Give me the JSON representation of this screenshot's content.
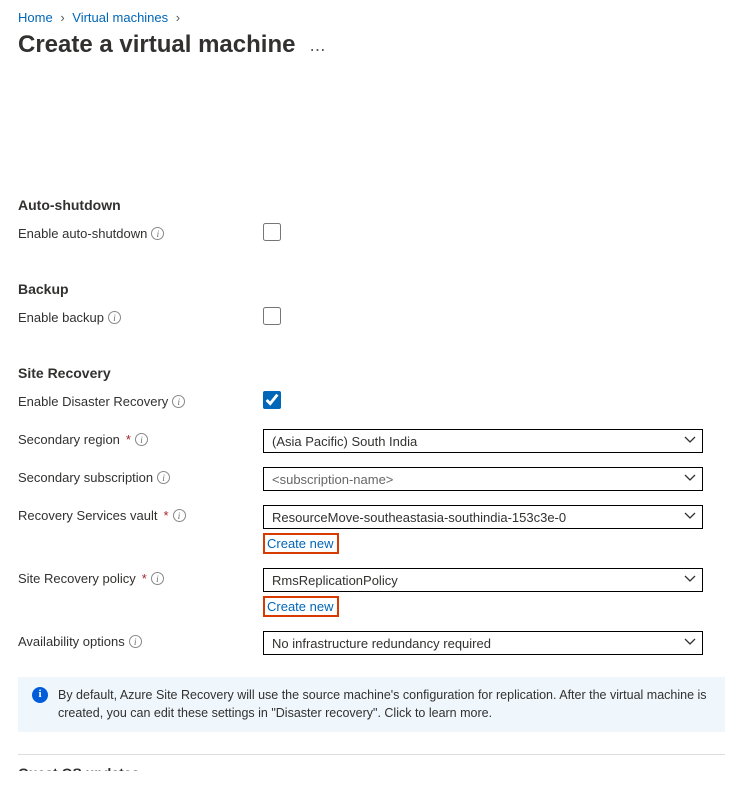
{
  "breadcrumb": {
    "home": "Home",
    "vms": "Virtual machines"
  },
  "page_title": "Create a virtual machine",
  "sections": {
    "auto_shutdown": {
      "heading": "Auto-shutdown",
      "enable_label": "Enable auto-shutdown",
      "enable_checked": false
    },
    "backup": {
      "heading": "Backup",
      "enable_label": "Enable backup",
      "enable_checked": false
    },
    "site_recovery": {
      "heading": "Site Recovery",
      "enable_label": "Enable Disaster Recovery",
      "enable_checked": true,
      "secondary_region_label": "Secondary region",
      "secondary_region_value": "(Asia Pacific) South India",
      "secondary_subscription_label": "Secondary subscription",
      "secondary_subscription_value": "<subscription-name>",
      "vault_label": "Recovery Services vault",
      "vault_value": "ResourceMove-southeastasia-southindia-153c3e-0",
      "vault_create_new": "Create new",
      "policy_label": "Site Recovery policy",
      "policy_value": "RmsReplicationPolicy",
      "policy_create_new": "Create new",
      "availability_label": "Availability options",
      "availability_value": "No infrastructure redundancy required"
    }
  },
  "banner_text": "By default, Azure Site Recovery will use the source machine's configuration for replication. After the virtual machine is created, you can edit these settings in \"Disaster recovery\". Click to learn more.",
  "next_heading_partial": "Guest OS updates"
}
